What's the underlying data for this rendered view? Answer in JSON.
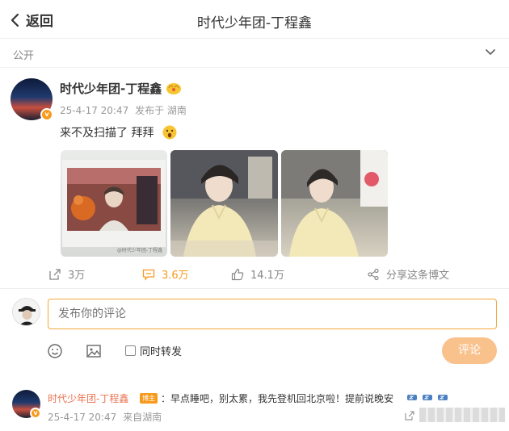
{
  "header": {
    "back_label": "返回",
    "title": "时代少年团-丁程鑫"
  },
  "visibility": {
    "label": "公开"
  },
  "post": {
    "author": "时代少年团-丁程鑫",
    "timestamp": "25-4-17 20:47",
    "source": "发布于 湖南",
    "text": "来不及扫描了 拜拜",
    "author_emoji": "hands-icon",
    "text_emoji": "surprised-face-icon",
    "images": [
      {
        "name": "photo-1",
        "watermark": "@时代少年团-丁程鑫"
      },
      {
        "name": "photo-2"
      },
      {
        "name": "photo-3"
      }
    ]
  },
  "actions": {
    "repost": "3万",
    "comment": "3.6万",
    "like": "14.1万",
    "share": "分享这条博文"
  },
  "composer": {
    "placeholder": "发布你的评论",
    "repost_label": "同时转发",
    "submit_label": "评论"
  },
  "comment": {
    "author": "时代少年团-丁程鑫",
    "badge": "博主",
    "text": "：早点睡吧，别太累，我先登机回北京啦！提前说晚安",
    "timestamp": "25-4-17 20:47",
    "source": "来自湖南"
  },
  "colors": {
    "accent": "#eb7350",
    "highlight": "#f79a1e",
    "submit_bg": "#f9c28d",
    "input_border": "#f2a93b"
  }
}
